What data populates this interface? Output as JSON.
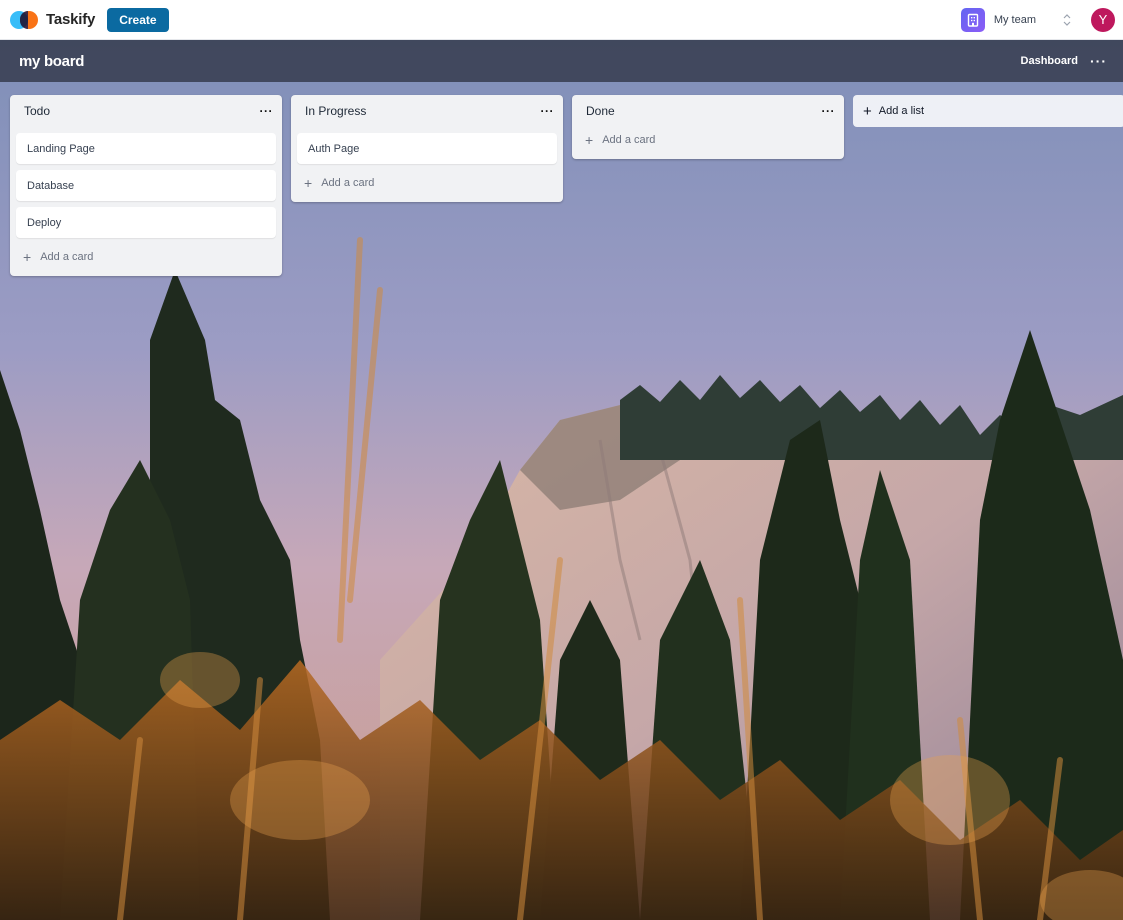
{
  "app": {
    "name": "Taskify",
    "create_label": "Create"
  },
  "team": {
    "name": "My team",
    "icon": "building-icon"
  },
  "user": {
    "avatar_initial": "Y",
    "avatar_color": "#be185d"
  },
  "board": {
    "title": "my board",
    "dashboard_label": "Dashboard",
    "menu_icon": "ellipsis-icon"
  },
  "lists": [
    {
      "title": "Todo",
      "cards": [
        "Landing Page",
        "Database",
        "Deploy"
      ],
      "add_card_label": "Add a card"
    },
    {
      "title": "In Progress",
      "cards": [
        "Auth Page"
      ],
      "add_card_label": "Add a card"
    },
    {
      "title": "Done",
      "cards": [],
      "add_card_label": "Add a card"
    }
  ],
  "add_list_label": "Add a list",
  "colors": {
    "brand_button": "#0b6aa1",
    "team_icon": "#7c3aed",
    "list_bg": "#f1f2f4"
  }
}
